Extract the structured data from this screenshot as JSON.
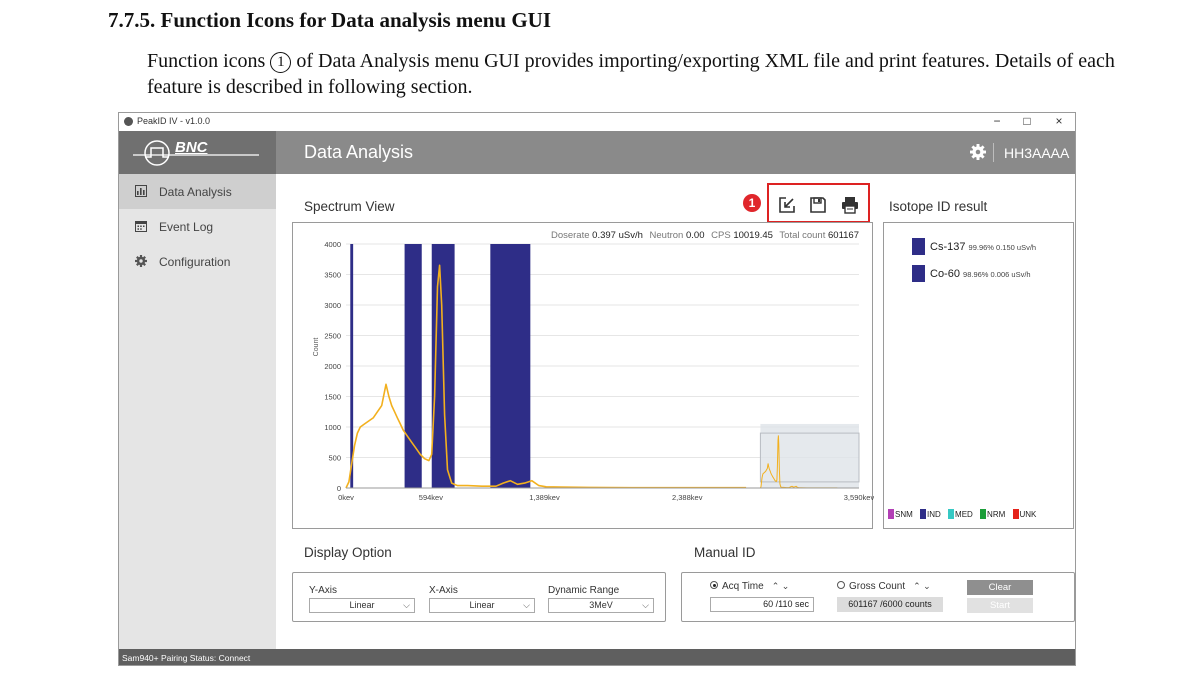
{
  "doc": {
    "heading": "7.7.5. Function Icons for Data analysis menu GUI",
    "para_start": "Function icons ",
    "circled": "1",
    "para_end": " of Data Analysis menu GUI provides importing/exporting XML file and print features. Details of each feature is described in following section."
  },
  "window": {
    "title": "PeakID IV - v1.0.0",
    "min": "−",
    "max": "□",
    "close": "×"
  },
  "sidebar": {
    "logo": "BNC",
    "items": [
      {
        "label": "Data Analysis",
        "icon": "chart-icon",
        "active": true
      },
      {
        "label": "Event Log",
        "icon": "calendar-icon",
        "active": false
      },
      {
        "label": "Configuration",
        "icon": "gear-icon",
        "active": false
      }
    ]
  },
  "header": {
    "title": "Data Analysis",
    "device": "HH3AAAA"
  },
  "spectrum": {
    "title": "Spectrum View",
    "badge": "1",
    "icons": [
      "import-icon",
      "save-icon",
      "print-icon"
    ],
    "stats": {
      "doserate_label": "Doserate",
      "doserate_value": "0.397 uSv/h",
      "neutron_label": "Neutron",
      "neutron_value": "0.00",
      "cps_label": "CPS",
      "cps_value": "10019.45",
      "total_label": "Total count",
      "total_value": "601167"
    }
  },
  "chart_data": {
    "type": "line",
    "title": "",
    "xlabel": "",
    "ylabel": "Count",
    "xlim": [
      0,
      3590
    ],
    "ylim": [
      0,
      4000
    ],
    "yticks": [
      0,
      500,
      1000,
      1500,
      2000,
      2500,
      3000,
      3500,
      4000
    ],
    "xticks": [
      {
        "value": 0,
        "label": "0kev"
      },
      {
        "value": 594,
        "label": "594kev"
      },
      {
        "value": 1389,
        "label": "1,389kev"
      },
      {
        "value": 2388,
        "label": "2,388kev"
      },
      {
        "value": 3590,
        "label": "3,590kev"
      }
    ],
    "grid": true,
    "region_bands": [
      {
        "x0": 30,
        "x1": 50,
        "color": "#2e2d87"
      },
      {
        "x0": 410,
        "x1": 530,
        "color": "#2e2d87"
      },
      {
        "x0": 600,
        "x1": 760,
        "color": "#2e2d87"
      },
      {
        "x0": 1010,
        "x1": 1290,
        "color": "#2e2d87"
      }
    ],
    "series": [
      {
        "color": "#f2b01e",
        "x": [
          0,
          20,
          40,
          60,
          80,
          100,
          130,
          160,
          190,
          220,
          250,
          280,
          300,
          320,
          340,
          360,
          380,
          400,
          430,
          460,
          490,
          520,
          550,
          580,
          600,
          620,
          640,
          655,
          670,
          690,
          710,
          740,
          780,
          850,
          950,
          1050,
          1100,
          1150,
          1200,
          1250,
          1300,
          1350,
          1400,
          1500,
          1700,
          2000,
          2400,
          2800
        ],
        "y": [
          0,
          100,
          400,
          700,
          900,
          1000,
          1050,
          1100,
          1150,
          1250,
          1350,
          1700,
          1500,
          1350,
          1250,
          1150,
          1050,
          950,
          850,
          750,
          650,
          550,
          480,
          450,
          550,
          1500,
          3300,
          3650,
          3000,
          1200,
          300,
          80,
          40,
          40,
          30,
          30,
          80,
          120,
          60,
          80,
          120,
          40,
          20,
          15,
          10,
          5,
          5,
          5
        ]
      }
    ],
    "overview_inset": true
  },
  "isotope": {
    "title": "Isotope ID result",
    "results": [
      {
        "name": "Cs-137",
        "detail": "99.96% 0.150 uSv/h",
        "color": "#2e2d87"
      },
      {
        "name": "Co-60",
        "detail": "98.96% 0.006 uSv/h",
        "color": "#2e2d87"
      }
    ],
    "legend": [
      {
        "label": "SNM",
        "color": "#b23fb5"
      },
      {
        "label": "IND",
        "color": "#2e2d87"
      },
      {
        "label": "MED",
        "color": "#36c9c4"
      },
      {
        "label": "NRM",
        "color": "#1c9e3a"
      },
      {
        "label": "UNK",
        "color": "#e5231b"
      }
    ]
  },
  "display_option": {
    "title": "Display Option",
    "y_axis_label": "Y-Axis",
    "y_axis_value": "Linear",
    "x_axis_label": "X-Axis",
    "x_axis_value": "Linear",
    "range_label": "Dynamic Range",
    "range_value": "3MeV",
    "chevron": "⌵"
  },
  "manual_id": {
    "title": "Manual ID",
    "acq_label": "Acq Time",
    "acq_value": "60 /110 sec",
    "gross_label": "Gross Count",
    "gross_value": "601167 /6000 counts",
    "arrows": "⌃ ⌄",
    "clear": "Clear",
    "start": "Start"
  },
  "status": {
    "text": "Sam940+ Pairing Status:  Connect"
  }
}
